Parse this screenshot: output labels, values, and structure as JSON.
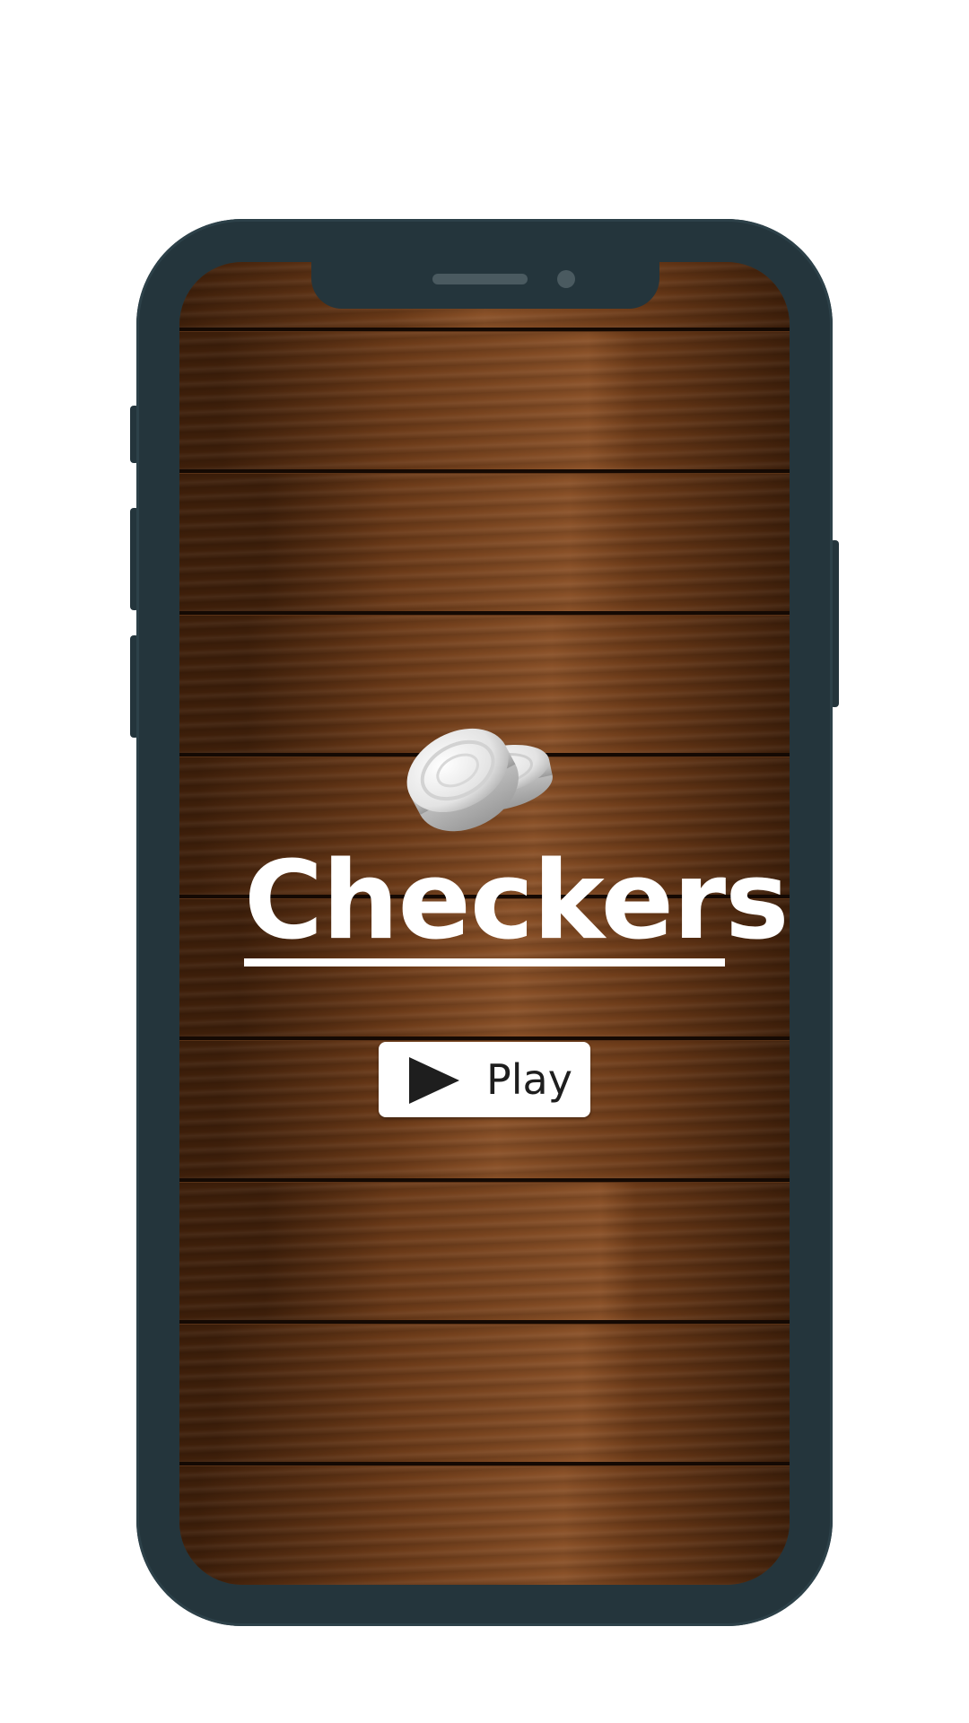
{
  "app": {
    "title": "Checkers",
    "logo_icon": "checker-pieces-icon"
  },
  "actions": {
    "play_label": "Play",
    "play_icon": "play-triangle-icon"
  },
  "device": {
    "frame_color": "#24353c",
    "screen_background": "wood-planks"
  },
  "colors": {
    "title": "#ffffff",
    "button_bg": "#ffffff",
    "button_text": "#1e1e1e",
    "wood_dark": "#3e1f0a",
    "wood_mid": "#6b3a18",
    "wood_light": "#8a5128"
  }
}
